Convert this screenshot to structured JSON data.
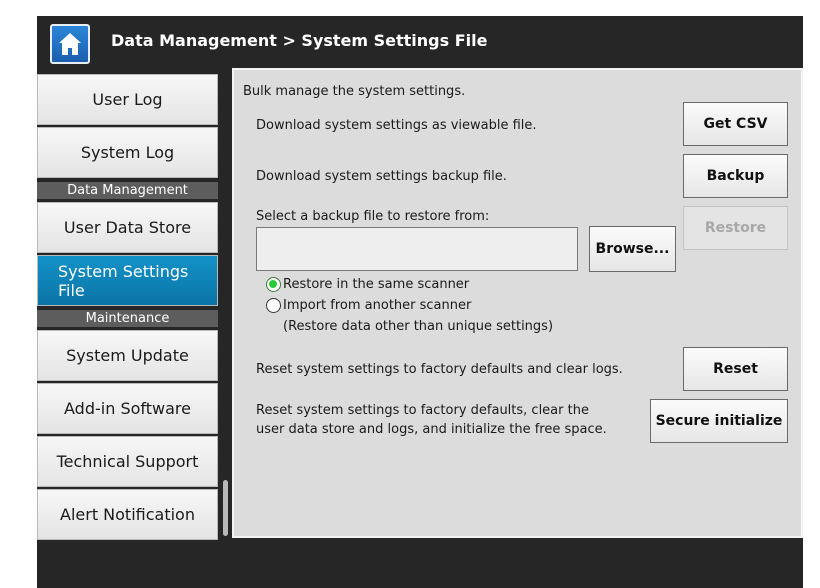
{
  "header": {
    "title": "Data Management > System Settings File",
    "home_icon": "home-icon"
  },
  "sidebar": {
    "items": [
      {
        "label": "User Log",
        "active": false
      },
      {
        "label": "System Log",
        "active": false
      },
      {
        "section": "Data Management"
      },
      {
        "label": "User Data Store",
        "active": false
      },
      {
        "label": "System Settings File",
        "active": true
      },
      {
        "section": "Maintenance"
      },
      {
        "label": "System Update",
        "active": false
      },
      {
        "label": "Add-in Software",
        "active": false
      },
      {
        "label": "Technical Support",
        "active": false
      },
      {
        "label": "Alert Notification",
        "active": false
      }
    ]
  },
  "main": {
    "intro": "Bulk manage the system settings.",
    "csv": {
      "description": "Download system settings as viewable file.",
      "button": "Get CSV"
    },
    "backup": {
      "description": "Download system settings backup file.",
      "button": "Backup"
    },
    "restore": {
      "label": "Select a backup file to restore from:",
      "file_value": "",
      "browse_button": "Browse...",
      "restore_button": "Restore",
      "restore_enabled": false,
      "options": [
        {
          "label": "Restore in the same scanner",
          "checked": true
        },
        {
          "label": "Import from another scanner",
          "checked": false
        }
      ],
      "note": "(Restore data other than unique settings)"
    },
    "reset": {
      "description": "Reset system settings to factory defaults and clear logs.",
      "button": "Reset"
    },
    "secure": {
      "description_line1": "Reset system settings to factory defaults, clear the",
      "description_line2": "user data store and logs, and initialize the free space.",
      "button": "Secure initialize"
    }
  },
  "colors": {
    "frame": "#262626",
    "active_nav": "#0a74a6",
    "radio_checked": "#29c93a",
    "content_bg": "#dcdcdc"
  }
}
